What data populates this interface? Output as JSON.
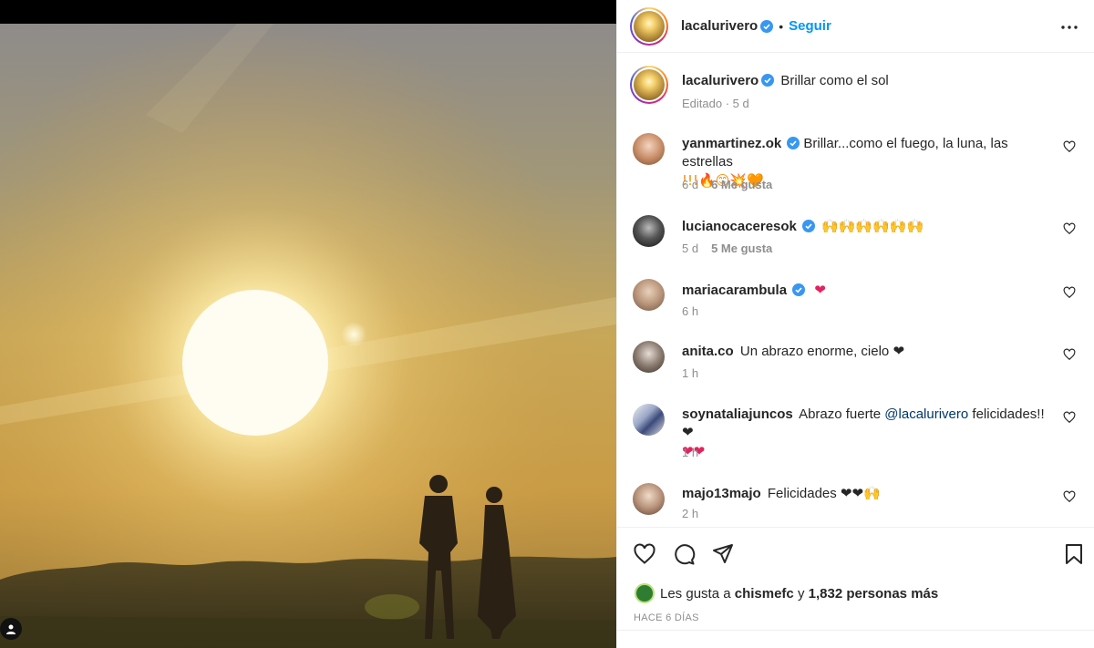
{
  "post": {
    "author": "lacalurivero",
    "follow_label": "Seguir",
    "separator": "•",
    "caption_text": "Brillar como el sol",
    "caption_meta": "Editado · 5 d"
  },
  "comments": [
    {
      "user": "yanmartinez.ok",
      "verified": true,
      "text_line1": "Brillar...como el fuego, la luna, las estrellas",
      "text_line2": "!!!🔥😊💥🧡",
      "time": "6 d",
      "likes": "6 Me gusta"
    },
    {
      "user": "lucianocaceresok",
      "verified": true,
      "text": "🙌🙌🙌🙌🙌🙌",
      "time": "5 d",
      "likes": "5 Me gusta"
    },
    {
      "user": "mariacarambula",
      "verified": true,
      "text": "❤",
      "time": "6 h"
    },
    {
      "user": "anita.co",
      "verified": false,
      "text": "Un abrazo enorme, cielo ❤",
      "time": "1 h"
    },
    {
      "user": "soynataliajuncos",
      "verified": false,
      "text_before": "Abrazo fuerte",
      "mention": "@lacalurivero",
      "text_after": "felicidades!!❤",
      "text_line2": "❤❤",
      "time": "1 h"
    },
    {
      "user": "majo13majo",
      "verified": false,
      "text": "Felicidades ❤❤🙌",
      "time": "2 h"
    }
  ],
  "likes_summary": {
    "prefix": "Les gusta a",
    "first_user": "chismefc",
    "joiner": "y",
    "others": "1,832 personas más"
  },
  "timestamp": "HACE 6 DÍAS",
  "icons": [
    "heart-icon",
    "comment-icon",
    "share-icon",
    "bookmark-icon",
    "more-icon",
    "verified-icon",
    "user-tag-icon"
  ],
  "colors": {
    "accent": "#0095f6",
    "verified": "#3897f0",
    "muted": "#8e8e8e",
    "heart": "#e0245e"
  }
}
